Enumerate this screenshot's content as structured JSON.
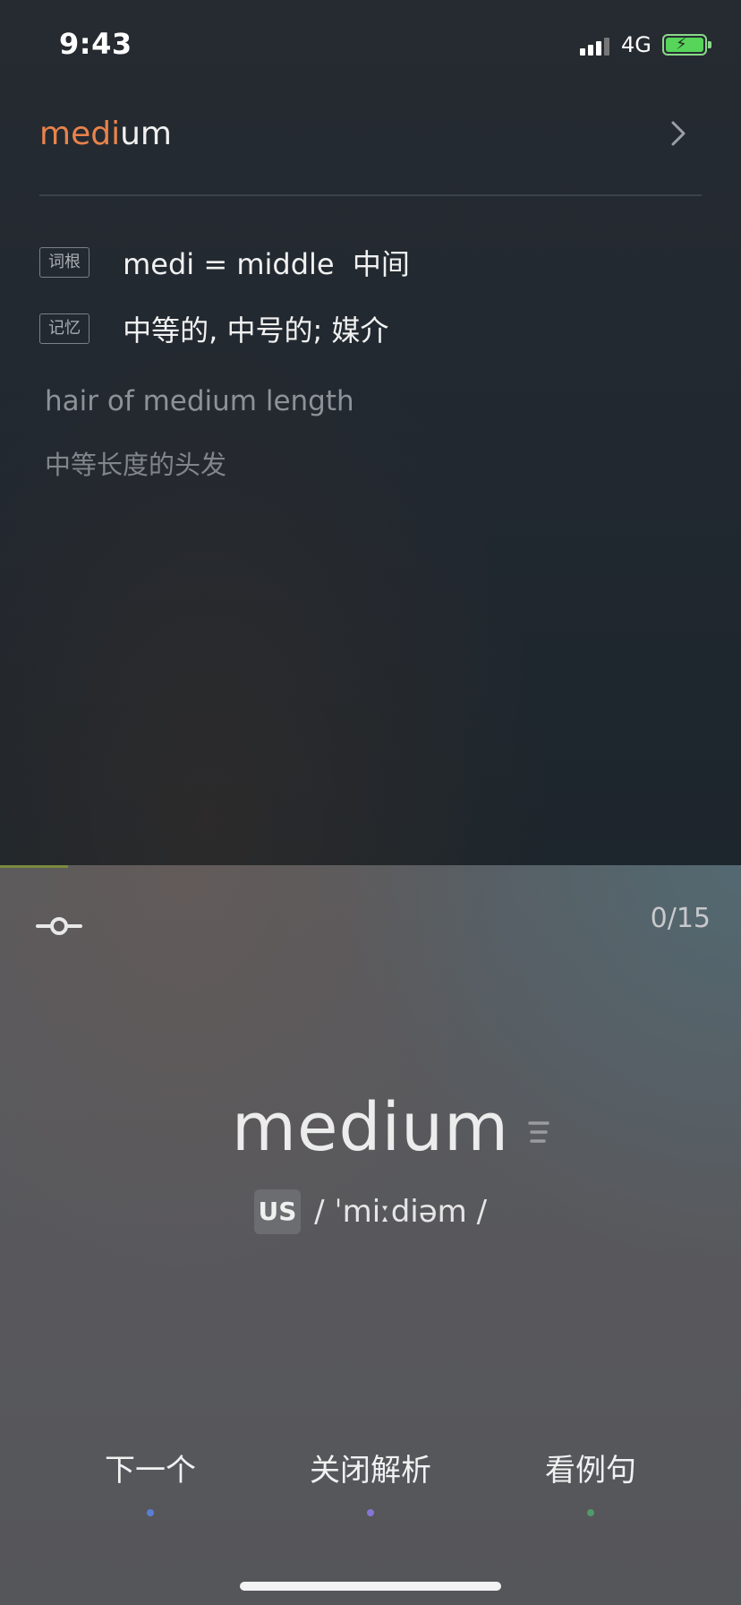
{
  "status": {
    "time": "9:43",
    "network": "4G"
  },
  "word": {
    "root_part": "medi",
    "rest_part": "um"
  },
  "root_row": {
    "tag": "词根",
    "text": "medi = middle  中间"
  },
  "memory_row": {
    "tag": "记忆",
    "text": "中等的, 中号的; 媒介"
  },
  "example": {
    "en": "hair of medium length",
    "zh": "中等长度的头发"
  },
  "card": {
    "counter": "0/15",
    "headword": "medium",
    "accent": "US",
    "phonetic": "/ ˈmiːdiəm /"
  },
  "actions": [
    {
      "label": "下一个",
      "dot_color": "#5b7fd6"
    },
    {
      "label": "关闭解析",
      "dot_color": "#8575d6"
    },
    {
      "label": "看例句",
      "dot_color": "#4f9a6a"
    }
  ],
  "colors": {
    "root_accent": "#e9834b",
    "battery": "#57d45a"
  }
}
